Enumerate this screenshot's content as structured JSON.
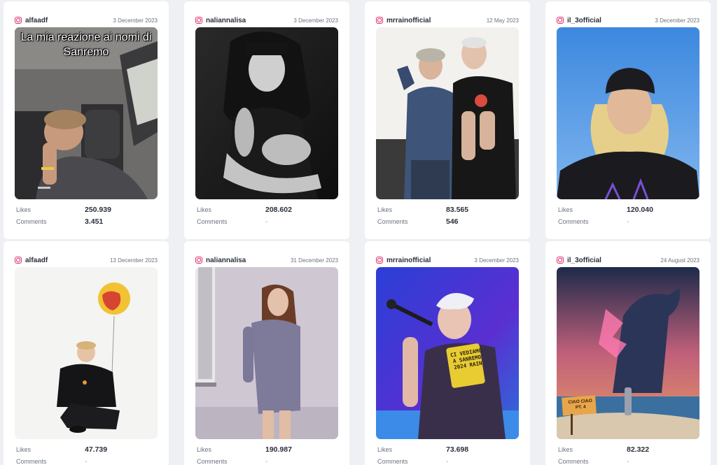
{
  "labels": {
    "likes": "Likes",
    "comments": "Comments"
  },
  "colors": {
    "instagram": "#e1306c",
    "card": "#ffffff",
    "page": "#eef0f4"
  },
  "posts": [
    {
      "username": "alfaadf",
      "date": "3 December 2023",
      "likes": "250.939",
      "comments": "3.451",
      "overlay": "La mia reazione ai nomi di Sanremo"
    },
    {
      "username": "naliannalisa",
      "date": "3 December 2023",
      "likes": "208.602",
      "comments": "-"
    },
    {
      "username": "mrrainofficial",
      "date": "12 May 2023",
      "likes": "83.565",
      "comments": "546"
    },
    {
      "username": "il_3official",
      "date": "3 December 2023",
      "likes": "120.040",
      "comments": "-"
    },
    {
      "username": "alfaadf",
      "date": "13 December 2023",
      "likes": "47.739",
      "comments": "-"
    },
    {
      "username": "naliannalisa",
      "date": "31 December 2023",
      "likes": "190.987",
      "comments": "-"
    },
    {
      "username": "mrrainofficial",
      "date": "3 December 2023",
      "likes": "73.698",
      "comments": "-",
      "sign": "CI VEDIAMO A SANREMO 2024 RAIN"
    },
    {
      "username": "il_3official",
      "date": "24 August 2023",
      "likes": "82.322",
      "comments": "-",
      "board": "CIAO CIAO PT. 4"
    }
  ]
}
